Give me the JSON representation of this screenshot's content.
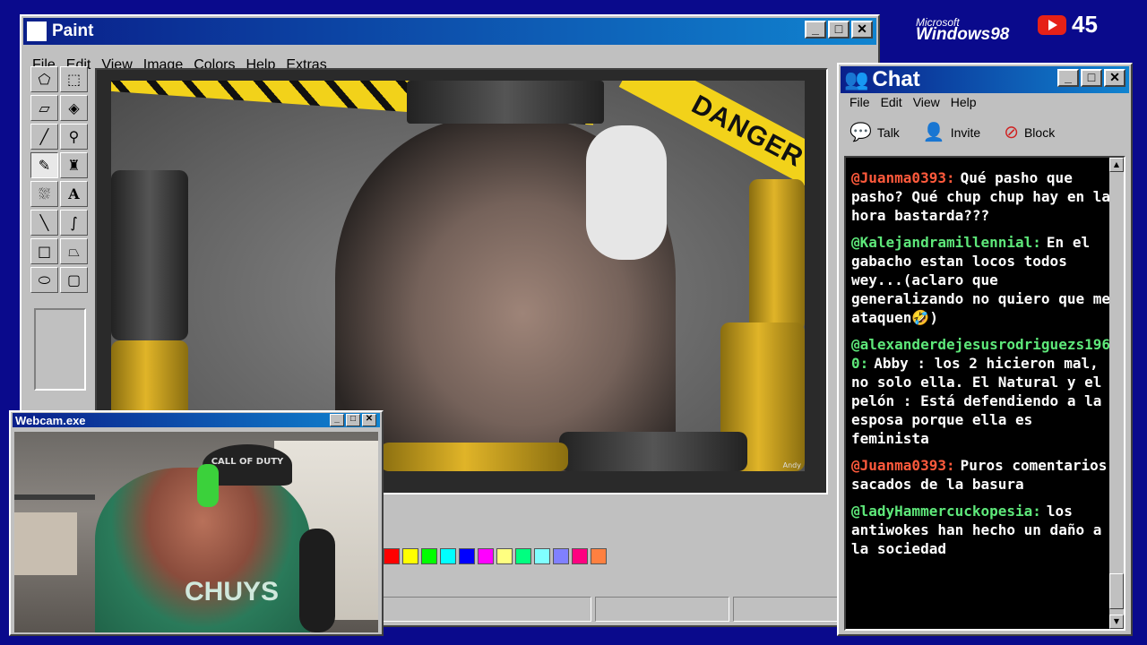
{
  "paint": {
    "title": "Paint",
    "menu": [
      "File",
      "Edit",
      "View",
      "Image",
      "Colors",
      "Help",
      "Extras"
    ],
    "canvas": {
      "banner_text": "DANGER",
      "credit": "Andy"
    },
    "palette": [
      "#ff0000",
      "#ffff00",
      "#00ff00",
      "#00ffff",
      "#0000ff",
      "#ff00ff",
      "#ffff80",
      "#00ff80",
      "#80ffff",
      "#8080ff",
      "#ff0080",
      "#ff8040"
    ],
    "tools": [
      "free-select",
      "rect-select",
      "eraser",
      "fill",
      "eyedropper",
      "magnifier",
      "pencil",
      "brush",
      "airbrush",
      "text",
      "line",
      "curve",
      "rectangle",
      "polygon",
      "ellipse",
      "rounded-rectangle"
    ]
  },
  "webcam": {
    "title": "Webcam.exe",
    "cap_text": "CALL OF DUTY",
    "shirt_text": "CHUYS"
  },
  "chat": {
    "title": "Chat",
    "menu": [
      "File",
      "Edit",
      "View",
      "Help"
    ],
    "toolbar": [
      {
        "label": "Talk",
        "icon": "talk-icon"
      },
      {
        "label": "Invite",
        "icon": "invite-icon"
      },
      {
        "label": "Block",
        "icon": "block-icon"
      }
    ],
    "messages": [
      {
        "user": "@Juanma0393:",
        "color": "#ff5a3c",
        "text": "Qué pasho que pasho? Qué chup chup hay en la hora bastarda???"
      },
      {
        "user": "@Kalejandramillennial:",
        "color": "#5ee87a",
        "text": "En el gabacho estan locos todos wey...(aclaro que generalizando no quiero que me ataquen🤣)"
      },
      {
        "user": "@alexanderdejesusrodriguezs1960:",
        "color": "#5ee87a",
        "text": "Abby : los 2 hicieron mal, no solo ella. El Natural y el pelón : Está defendiendo a la esposa porque ella es feminista"
      },
      {
        "user": "@Juanma0393:",
        "color": "#ff5a3c",
        "text": "Puros comentarios sacados de la basura"
      },
      {
        "user": "@ladyHammercuckopesia:",
        "color": "#5ee87a",
        "text": "los antiwokes han hecho un daño a la sociedad"
      }
    ]
  },
  "branding": {
    "microsoft": "Microsoft",
    "windows": "Windows98",
    "youtube_count": "45"
  },
  "titlebar_buttons": [
    "_",
    "□",
    "✕"
  ]
}
